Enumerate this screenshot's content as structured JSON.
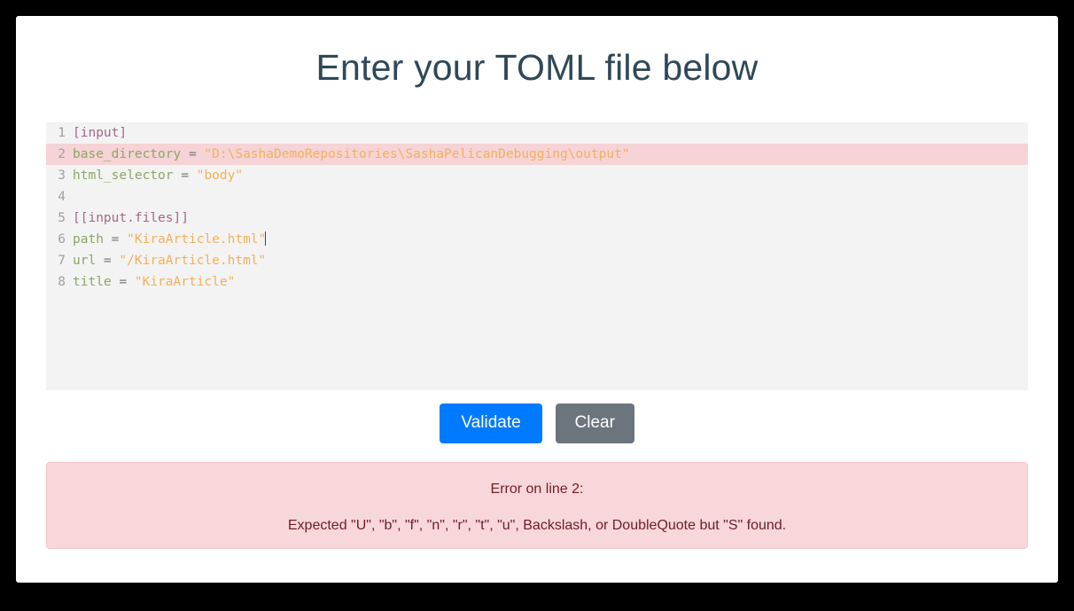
{
  "page": {
    "title": "Enter your TOML file below"
  },
  "editor": {
    "name": "toml-editor",
    "caret_line": 6,
    "error_line": 2,
    "lines": [
      {
        "num": "1",
        "segments": [
          {
            "type": "table",
            "text": "[input]"
          }
        ]
      },
      {
        "num": "2",
        "error": true,
        "segments": [
          {
            "type": "key",
            "text": "base_directory"
          },
          {
            "type": "eq",
            "text": " = "
          },
          {
            "type": "str",
            "text": "\"D:\\SashaDemoRepositories\\SashaPelicanDebugging\\output\""
          }
        ]
      },
      {
        "num": "3",
        "segments": [
          {
            "type": "key",
            "text": "html_selector"
          },
          {
            "type": "eq",
            "text": " = "
          },
          {
            "type": "str",
            "text": "\"body\""
          }
        ]
      },
      {
        "num": "4",
        "segments": []
      },
      {
        "num": "5",
        "segments": [
          {
            "type": "table",
            "text": "[[input.files]]"
          }
        ]
      },
      {
        "num": "6",
        "caret": true,
        "segments": [
          {
            "type": "key",
            "text": "path"
          },
          {
            "type": "eq",
            "text": " = "
          },
          {
            "type": "str",
            "text": "\"KiraArticle.html\""
          }
        ]
      },
      {
        "num": "7",
        "segments": [
          {
            "type": "key",
            "text": "url"
          },
          {
            "type": "eq",
            "text": " = "
          },
          {
            "type": "str",
            "text": "\"/KiraArticle.html\""
          }
        ]
      },
      {
        "num": "8",
        "segments": [
          {
            "type": "key",
            "text": "title"
          },
          {
            "type": "eq",
            "text": " = "
          },
          {
            "type": "str",
            "text": "\"KiraArticle\""
          }
        ]
      }
    ]
  },
  "buttons": {
    "validate_label": "Validate",
    "clear_label": "Clear"
  },
  "error": {
    "heading": "Error on line 2:",
    "detail": "Expected \"U\", \"b\", \"f\", \"n\", \"r\", \"t\", \"u\", Backslash, or DoubleQuote but \"S\" found."
  },
  "colors": {
    "accent": "#007bff",
    "secondary": "#6c757d",
    "error_bg": "#f8d7da",
    "error_border": "#f5c6cb",
    "error_text": "#721c24",
    "editor_bg": "#f3f3f3",
    "error_line_bg": "#f6d3d6",
    "title_text": "#2f4858",
    "token_table": "#a4678c",
    "token_key": "#8aa763",
    "token_string": "#f2b159",
    "token_equals": "#7a7a7a",
    "line_number": "#a0a0a0",
    "page_bg": "#ffffff",
    "frame_bg": "#000000"
  }
}
